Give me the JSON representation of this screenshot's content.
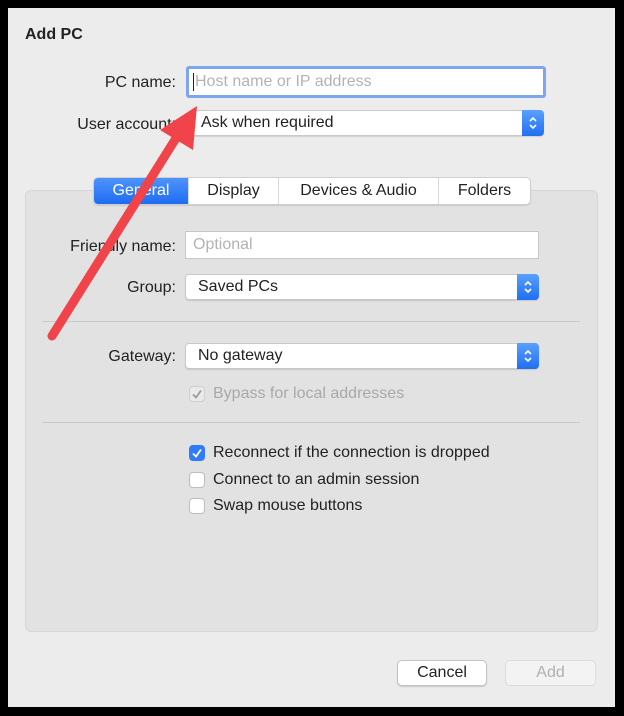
{
  "dialog": {
    "title": "Add PC",
    "pc_name": {
      "label": "PC name:",
      "value": "",
      "placeholder": "Host name or IP address"
    },
    "user_account": {
      "label": "User account:",
      "value": "Ask when required"
    },
    "tabs": [
      {
        "label": "General",
        "active": true
      },
      {
        "label": "Display",
        "active": false
      },
      {
        "label": "Devices & Audio",
        "active": false
      },
      {
        "label": "Folders",
        "active": false
      }
    ],
    "general": {
      "friendly_name": {
        "label": "Friendly name:",
        "value": "",
        "placeholder": "Optional"
      },
      "group": {
        "label": "Group:",
        "value": "Saved PCs"
      },
      "gateway": {
        "label": "Gateway:",
        "value": "No gateway"
      },
      "bypass": {
        "label": "Bypass for local addresses",
        "checked": true,
        "enabled": false
      },
      "options": [
        {
          "label": "Reconnect if the connection is dropped",
          "checked": true
        },
        {
          "label": "Connect to an admin session",
          "checked": false
        },
        {
          "label": "Swap mouse buttons",
          "checked": false
        }
      ]
    },
    "buttons": {
      "cancel": "Cancel",
      "add": "Add"
    }
  },
  "annotation": {
    "type": "arrow",
    "color": "#f0434a",
    "points_to": "user-account-popup"
  },
  "colors": {
    "accent": "#1d6cf2",
    "focus_ring": "#7ea6ee",
    "window_bg": "#ececec",
    "panel_bg": "#e2e2e2"
  }
}
